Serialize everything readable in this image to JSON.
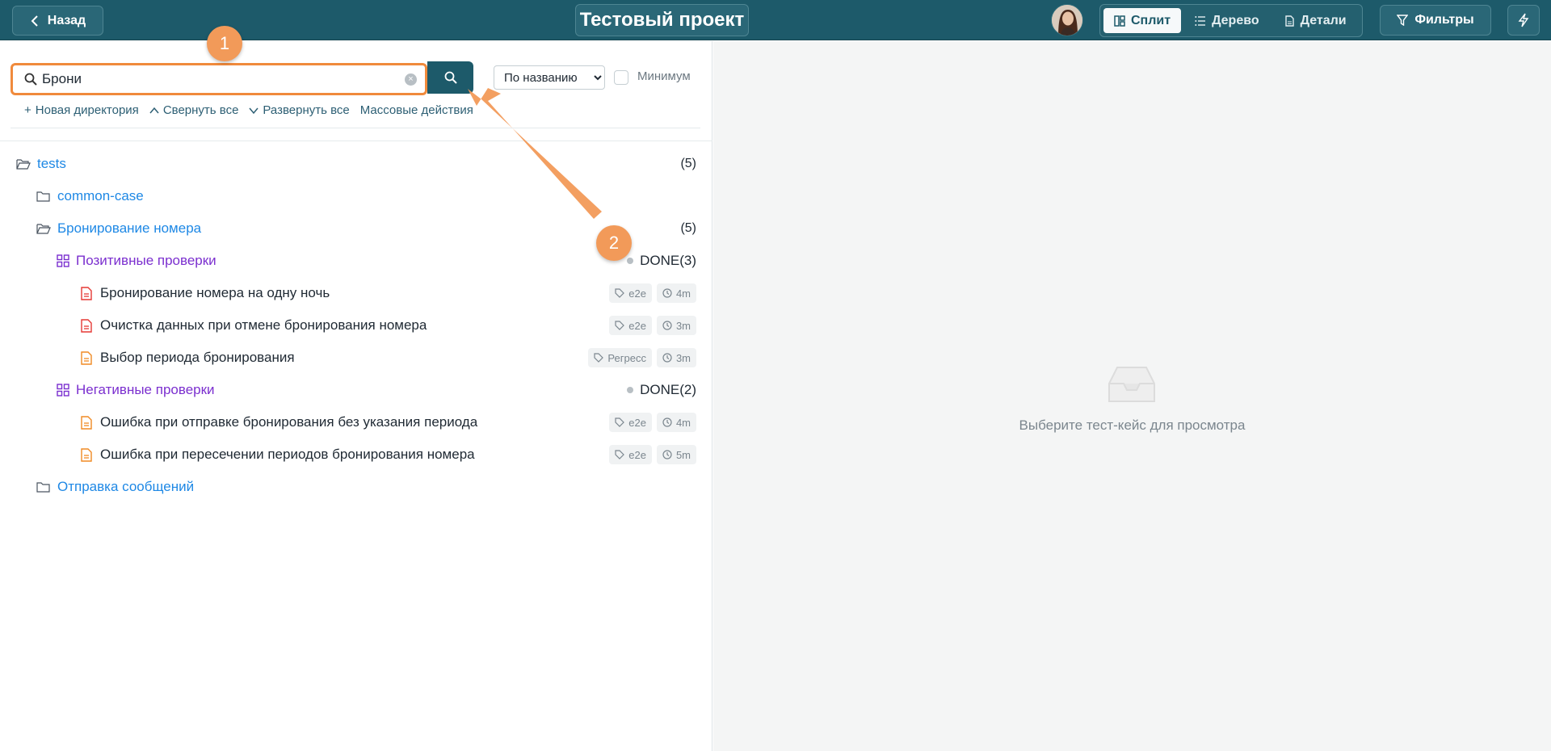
{
  "header": {
    "back_label": "Назад",
    "project_title": "Тестовый проект",
    "view_modes": [
      "Сплит",
      "Дерево",
      "Детали"
    ],
    "active_view": "Сплит",
    "filters_label": "Фильтры"
  },
  "search": {
    "value": "Брони",
    "sort_selected": "По названию",
    "minimum_label": "Минимум"
  },
  "actions": {
    "new_dir": "Новая директория",
    "collapse_all": "Свернуть все",
    "expand_all": "Развернуть все",
    "bulk": "Массовые действия"
  },
  "tree": {
    "root": {
      "name": "tests",
      "count": "(5)"
    },
    "dirs": {
      "common": {
        "name": "common-case"
      },
      "booking": {
        "name": "Бронирование номера",
        "count": "(5)"
      },
      "messages": {
        "name": "Отправка сообщений"
      }
    },
    "suites": {
      "positive": {
        "name": "Позитивные проверки",
        "status": "DONE",
        "count": "(3)"
      },
      "negative": {
        "name": "Негативные проверки",
        "status": "DONE",
        "count": "(2)"
      }
    },
    "cases": [
      {
        "name": "Бронирование номера на одну ночь",
        "tag": "e2e",
        "time": "4m",
        "color": "#e53935"
      },
      {
        "name": "Очистка данных при отмене бронирования номера",
        "tag": "e2e",
        "time": "3m",
        "color": "#e53935"
      },
      {
        "name": "Выбор периода бронирования",
        "tag": "Регресс",
        "time": "3m",
        "color": "#f08a24"
      },
      {
        "name": "Ошибка при отправке бронирования без указания периода",
        "tag": "e2e",
        "time": "4m",
        "color": "#f08a24"
      },
      {
        "name": "Ошибка при пересечении периодов бронирования номера",
        "tag": "e2e",
        "time": "5m",
        "color": "#f08a24"
      }
    ]
  },
  "empty": {
    "text": "Выберите тест-кейс для просмотра"
  },
  "callouts": {
    "one": "1",
    "two": "2"
  },
  "colors": {
    "header": "#1d5a6a",
    "accent": "#f29a59",
    "dir": "#1e88e5",
    "suite": "#7b2fcf"
  }
}
